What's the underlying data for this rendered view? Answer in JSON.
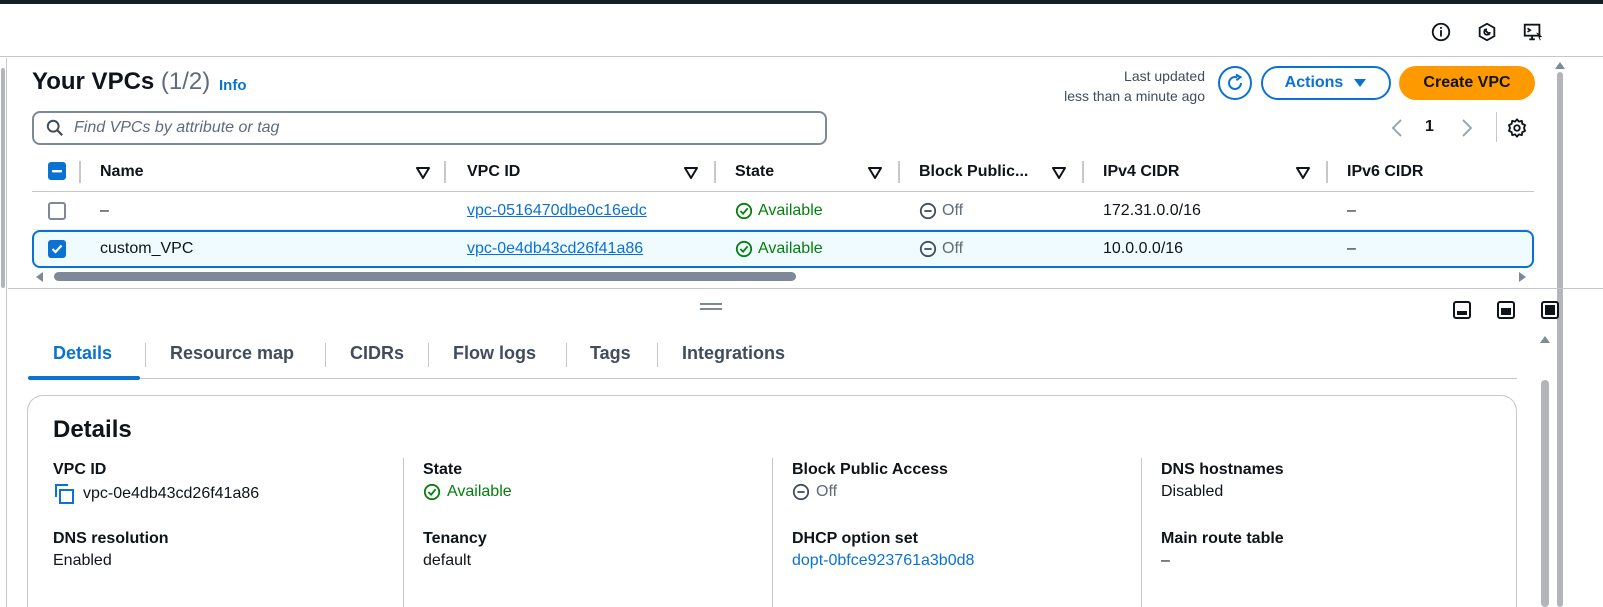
{
  "header": {
    "title": "Your VPCs",
    "count": "(1/2)",
    "info_link": "Info",
    "last_updated_label": "Last updated",
    "last_updated_value": "less than a minute ago",
    "actions_label": "Actions",
    "create_label": "Create VPC"
  },
  "search": {
    "placeholder": "Find VPCs by attribute or tag",
    "value": ""
  },
  "pagination": {
    "current_page": "1"
  },
  "table": {
    "columns": [
      "Name",
      "VPC ID",
      "State",
      "Block Public...",
      "IPv4 CIDR",
      "IPv6 CIDR"
    ],
    "rows": [
      {
        "name": "–",
        "vpc_id": "vpc-0516470dbe0c16edc",
        "state": "Available",
        "block_public": "Off",
        "ipv4": "172.31.0.0/16",
        "ipv6": "–",
        "selected": false
      },
      {
        "name": "custom_VPC",
        "vpc_id": "vpc-0e4db43cd26f41a86",
        "state": "Available",
        "block_public": "Off",
        "ipv4": "10.0.0.0/16",
        "ipv6": "–",
        "selected": true
      }
    ]
  },
  "tabs": [
    {
      "label": "Details",
      "active": true
    },
    {
      "label": "Resource map"
    },
    {
      "label": "CIDRs"
    },
    {
      "label": "Flow logs"
    },
    {
      "label": "Tags"
    },
    {
      "label": "Integrations"
    }
  ],
  "details": {
    "title": "Details",
    "vpc_id_label": "VPC ID",
    "vpc_id_value": "vpc-0e4db43cd26f41a86",
    "state_label": "State",
    "state_value": "Available",
    "block_label": "Block Public Access",
    "block_value": "Off",
    "dns_hostnames_label": "DNS hostnames",
    "dns_hostnames_value": "Disabled",
    "dns_resolution_label": "DNS resolution",
    "dns_resolution_value": "Enabled",
    "tenancy_label": "Tenancy",
    "tenancy_value": "default",
    "dhcp_label": "DHCP option set",
    "dhcp_value": "dopt-0bfce923761a3b0d8",
    "main_route_label": "Main route table",
    "main_route_value": "–"
  },
  "icons": [
    "info-icon",
    "notifications-icon",
    "cloudshell-icon",
    "search-icon",
    "refresh-icon",
    "caret-down-icon",
    "chevron-left-icon",
    "chevron-right-icon",
    "gear-icon",
    "sort-icon",
    "status-available-icon",
    "status-off-icon",
    "copy-icon",
    "panel-bottom-icon",
    "panel-side-icon",
    "panel-full-icon"
  ],
  "colors": {
    "accent": "#0972d3",
    "primary_button": "#ff9900",
    "success": "#037f0c",
    "muted": "#5f6b7a",
    "topbar": "#161d26"
  }
}
